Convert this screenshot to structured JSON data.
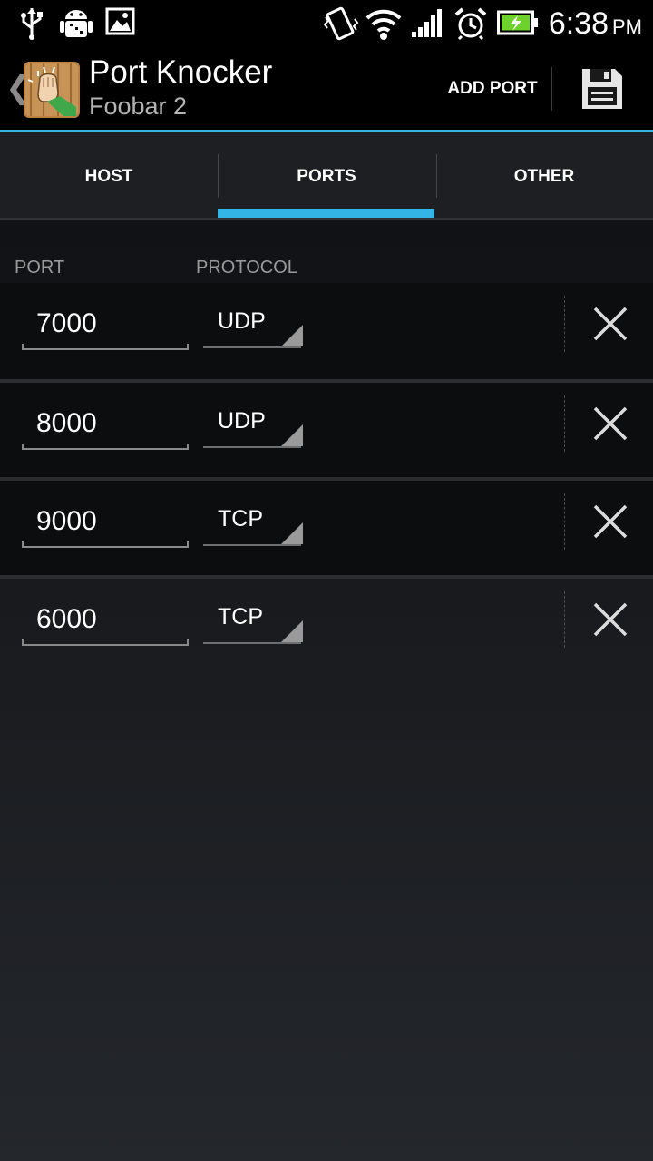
{
  "status_bar": {
    "time": "6:38",
    "ampm": "PM",
    "icons": [
      "usb-icon",
      "android-debug-icon",
      "image-notification-icon",
      "vibrate-icon",
      "wifi-icon",
      "signal-icon",
      "alarm-icon",
      "battery-charging-icon"
    ]
  },
  "action_bar": {
    "title": "Port Knocker",
    "subtitle": "Foobar 2",
    "add_port_label": "ADD PORT",
    "save_icon": "save-icon",
    "accent_color": "#33b5e5"
  },
  "tabs": [
    {
      "label": "HOST",
      "selected": false
    },
    {
      "label": "PORTS",
      "selected": true
    },
    {
      "label": "OTHER",
      "selected": false
    }
  ],
  "columns": {
    "port": "PORT",
    "protocol": "PROTOCOL"
  },
  "ports": [
    {
      "port": "7000",
      "protocol": "UDP"
    },
    {
      "port": "8000",
      "protocol": "UDP"
    },
    {
      "port": "9000",
      "protocol": "TCP"
    },
    {
      "port": "6000",
      "protocol": "TCP"
    }
  ]
}
